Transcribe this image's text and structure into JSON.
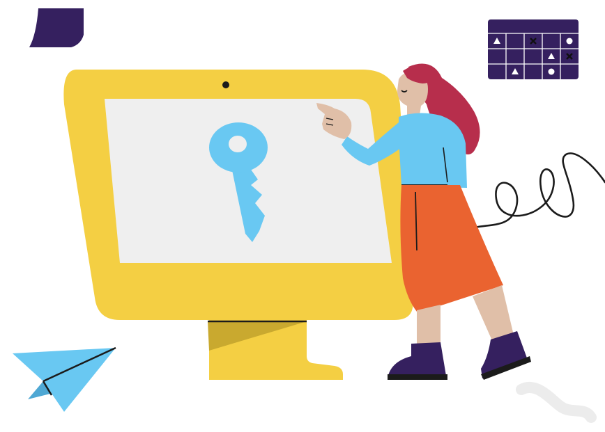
{
  "scene": {
    "colors": {
      "background": "#ffffff",
      "monitor_frame": "#F4CF43",
      "monitor_stand_shadow": "#C9A92F",
      "screen": "#EFEFEF",
      "key": "#69C8F2",
      "dark_purple": "#35205F",
      "hair": "#B72E4C",
      "skin": "#E0BFA8",
      "shirt": "#69C8F2",
      "skirt": "#EA6330",
      "outline": "#1B1B1B",
      "paper_plane": "#69C8F2"
    },
    "icons": [
      "monitor-icon",
      "key-icon",
      "woman-illustration",
      "calendar-grid-icon",
      "paper-plane-icon",
      "folded-corner-shape",
      "scribble-line",
      "faint-wave"
    ],
    "calendar_marks": [
      {
        "row": 0,
        "col": 0,
        "symbol": "triangle"
      },
      {
        "row": 0,
        "col": 2,
        "symbol": "cross"
      },
      {
        "row": 0,
        "col": 4,
        "symbol": "circle"
      },
      {
        "row": 1,
        "col": 3,
        "symbol": "triangle"
      },
      {
        "row": 1,
        "col": 4,
        "symbol": "cross"
      },
      {
        "row": 2,
        "col": 1,
        "symbol": "triangle"
      },
      {
        "row": 2,
        "col": 3,
        "symbol": "circle"
      }
    ]
  }
}
